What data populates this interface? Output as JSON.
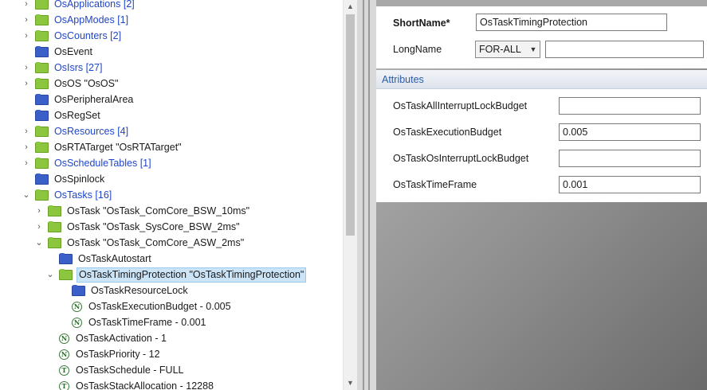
{
  "tree": {
    "items": [
      {
        "label": "OsApplications [2]",
        "style": "link",
        "icon": "green-folder-icon",
        "toggle": ">"
      },
      {
        "label": "OsAppModes [1]",
        "style": "link",
        "icon": "green-folder-icon",
        "toggle": ">"
      },
      {
        "label": "OsCounters [2]",
        "style": "link",
        "icon": "green-folder-icon",
        "toggle": ">"
      },
      {
        "label": "OsEvent",
        "style": "plain",
        "icon": "blue-folder-icon",
        "toggle": ""
      },
      {
        "label": "OsIsrs [27]",
        "style": "link",
        "icon": "green-folder-icon",
        "toggle": ">"
      },
      {
        "label": "OsOS \"OsOS\"",
        "style": "plain",
        "icon": "green-folder-icon",
        "toggle": ">"
      },
      {
        "label": "OsPeripheralArea",
        "style": "plain",
        "icon": "blue-folder-icon",
        "toggle": ""
      },
      {
        "label": "OsRegSet",
        "style": "plain",
        "icon": "blue-folder-icon",
        "toggle": ""
      },
      {
        "label": "OsResources [4]",
        "style": "link",
        "icon": "green-folder-icon",
        "toggle": ">"
      },
      {
        "label": "OsRTATarget \"OsRTATarget\"",
        "style": "plain",
        "icon": "green-folder-icon",
        "toggle": ">"
      },
      {
        "label": "OsScheduleTables [1]",
        "style": "link",
        "icon": "green-folder-icon",
        "toggle": ">"
      },
      {
        "label": "OsSpinlock",
        "style": "plain",
        "icon": "blue-folder-icon",
        "toggle": ""
      },
      {
        "label": "OsTasks [16]",
        "style": "link",
        "icon": "green-folder-icon",
        "toggle": "v"
      },
      {
        "label": "OsTask \"OsTask_ComCore_BSW_10ms\"",
        "style": "plain",
        "icon": "green-folder-icon",
        "toggle": ">"
      },
      {
        "label": "OsTask \"OsTask_SysCore_BSW_2ms\"",
        "style": "plain",
        "icon": "green-folder-icon",
        "toggle": ">"
      },
      {
        "label": "OsTask \"OsTask_ComCore_ASW_2ms\"",
        "style": "plain",
        "icon": "green-folder-icon",
        "toggle": "v"
      },
      {
        "label": "OsTaskAutostart",
        "style": "plain",
        "icon": "blue-folder-icon",
        "toggle": ""
      },
      {
        "label": "OsTaskTimingProtection \"OsTaskTimingProtection\"",
        "style": "selected",
        "icon": "green-folder-icon",
        "toggle": "v"
      },
      {
        "label": "OsTaskResourceLock",
        "style": "plain",
        "icon": "blue-folder-icon",
        "toggle": ""
      },
      {
        "label": "OsTaskExecutionBudget - 0.005",
        "style": "plain",
        "icon": "numeric-param-icon",
        "glyph": "N",
        "toggle": ""
      },
      {
        "label": "OsTaskTimeFrame - 0.001",
        "style": "plain",
        "icon": "numeric-param-icon",
        "glyph": "N",
        "toggle": ""
      },
      {
        "label": "OsTaskActivation - 1",
        "style": "plain",
        "icon": "numeric-param-icon",
        "glyph": "N",
        "toggle": ""
      },
      {
        "label": "OsTaskPriority - 12",
        "style": "plain",
        "icon": "numeric-param-icon",
        "glyph": "N",
        "toggle": ""
      },
      {
        "label": "OsTaskSchedule - FULL",
        "style": "plain",
        "icon": "text-param-icon",
        "glyph": "T",
        "toggle": ""
      },
      {
        "label": "OsTaskStackAllocation - 12288",
        "style": "plain",
        "icon": "text-param-icon",
        "glyph": "T",
        "toggle": ""
      }
    ]
  },
  "scrollbar": {
    "up": "▲",
    "down": "▼"
  },
  "general": {
    "short_name_label": "ShortName*",
    "short_name_value": "OsTaskTimingProtection",
    "long_name_label": "LongName",
    "long_name_lang": "FOR-ALL",
    "long_name_value": ""
  },
  "attributes": {
    "header": "Attributes",
    "fields": [
      {
        "label": "OsTaskAllInterruptLockBudget",
        "value": ""
      },
      {
        "label": "OsTaskExecutionBudget",
        "value": "0.005"
      },
      {
        "label": "OsTaskOsInterruptLockBudget",
        "value": ""
      },
      {
        "label": "OsTaskTimeFrame",
        "value": "0.001"
      }
    ]
  },
  "colors": {
    "link": "#2046c8",
    "selection": "#cce4f7",
    "folder_green": "#8cc63f",
    "folder_blue": "#3b5fc9"
  }
}
